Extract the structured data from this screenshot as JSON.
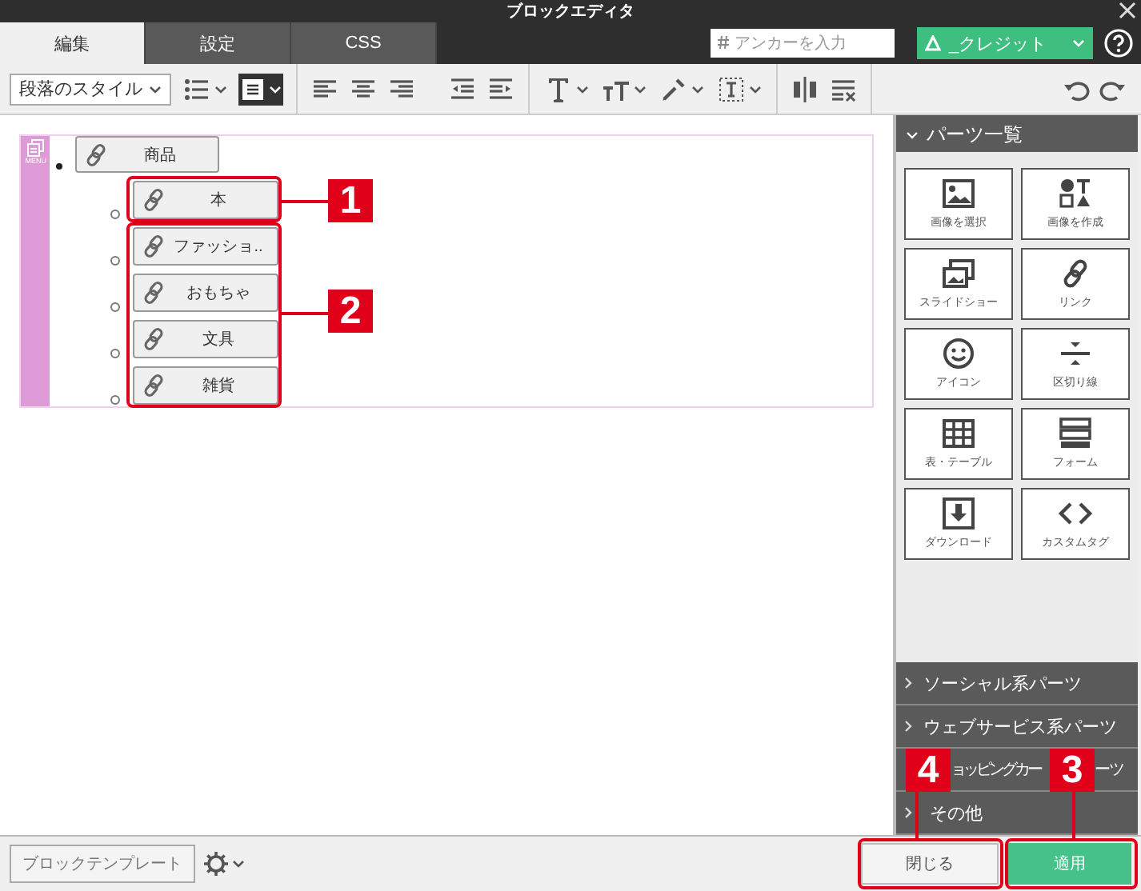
{
  "window": {
    "title": "ブロックエディタ"
  },
  "tabs": [
    {
      "label": "編集",
      "selected": true
    },
    {
      "label": "設定",
      "selected": false
    },
    {
      "label": "CSS",
      "selected": false
    }
  ],
  "anchor_field": {
    "placeholder": "アンカーを入力"
  },
  "credit_dropdown": {
    "label": "_クレジット"
  },
  "toolbar": {
    "paragraph_style": "段落のスタイル",
    "block_format_active": true
  },
  "menu_block": {
    "label": "MENU",
    "items": [
      {
        "label": "商品",
        "children": [
          {
            "label": "本"
          },
          {
            "label": "ファッショ.."
          },
          {
            "label": "おもちゃ"
          },
          {
            "label": "文具"
          },
          {
            "label": "雑貨"
          }
        ]
      }
    ]
  },
  "parts_panel": {
    "title": "パーツ一覧",
    "expanded": true,
    "parts": [
      {
        "label": "画像を選択"
      },
      {
        "label": "画像を作成"
      },
      {
        "label": "スライドショー"
      },
      {
        "label": "リンク"
      },
      {
        "label": "アイコン"
      },
      {
        "label": "区切り線"
      },
      {
        "label": "表・テーブル"
      },
      {
        "label": "フォーム"
      },
      {
        "label": "ダウンロード"
      },
      {
        "label": "カスタムタグ"
      }
    ],
    "sections": [
      {
        "label": "ソーシャル系パーツ",
        "expanded": false
      },
      {
        "label": "ウェブサービス系パーツ",
        "expanded": false
      },
      {
        "label": "ョッピングカー",
        "label_tail": "ーツ",
        "kind": "covered",
        "expanded": false
      },
      {
        "label": "その他",
        "expanded": false
      }
    ]
  },
  "footer": {
    "template_button": "ブロックテンプレート",
    "close_button": "閉じる",
    "apply_button": "適用"
  },
  "annotations": [
    {
      "number": "1"
    },
    {
      "number": "2"
    },
    {
      "number": "4"
    },
    {
      "number": "3"
    }
  ]
}
